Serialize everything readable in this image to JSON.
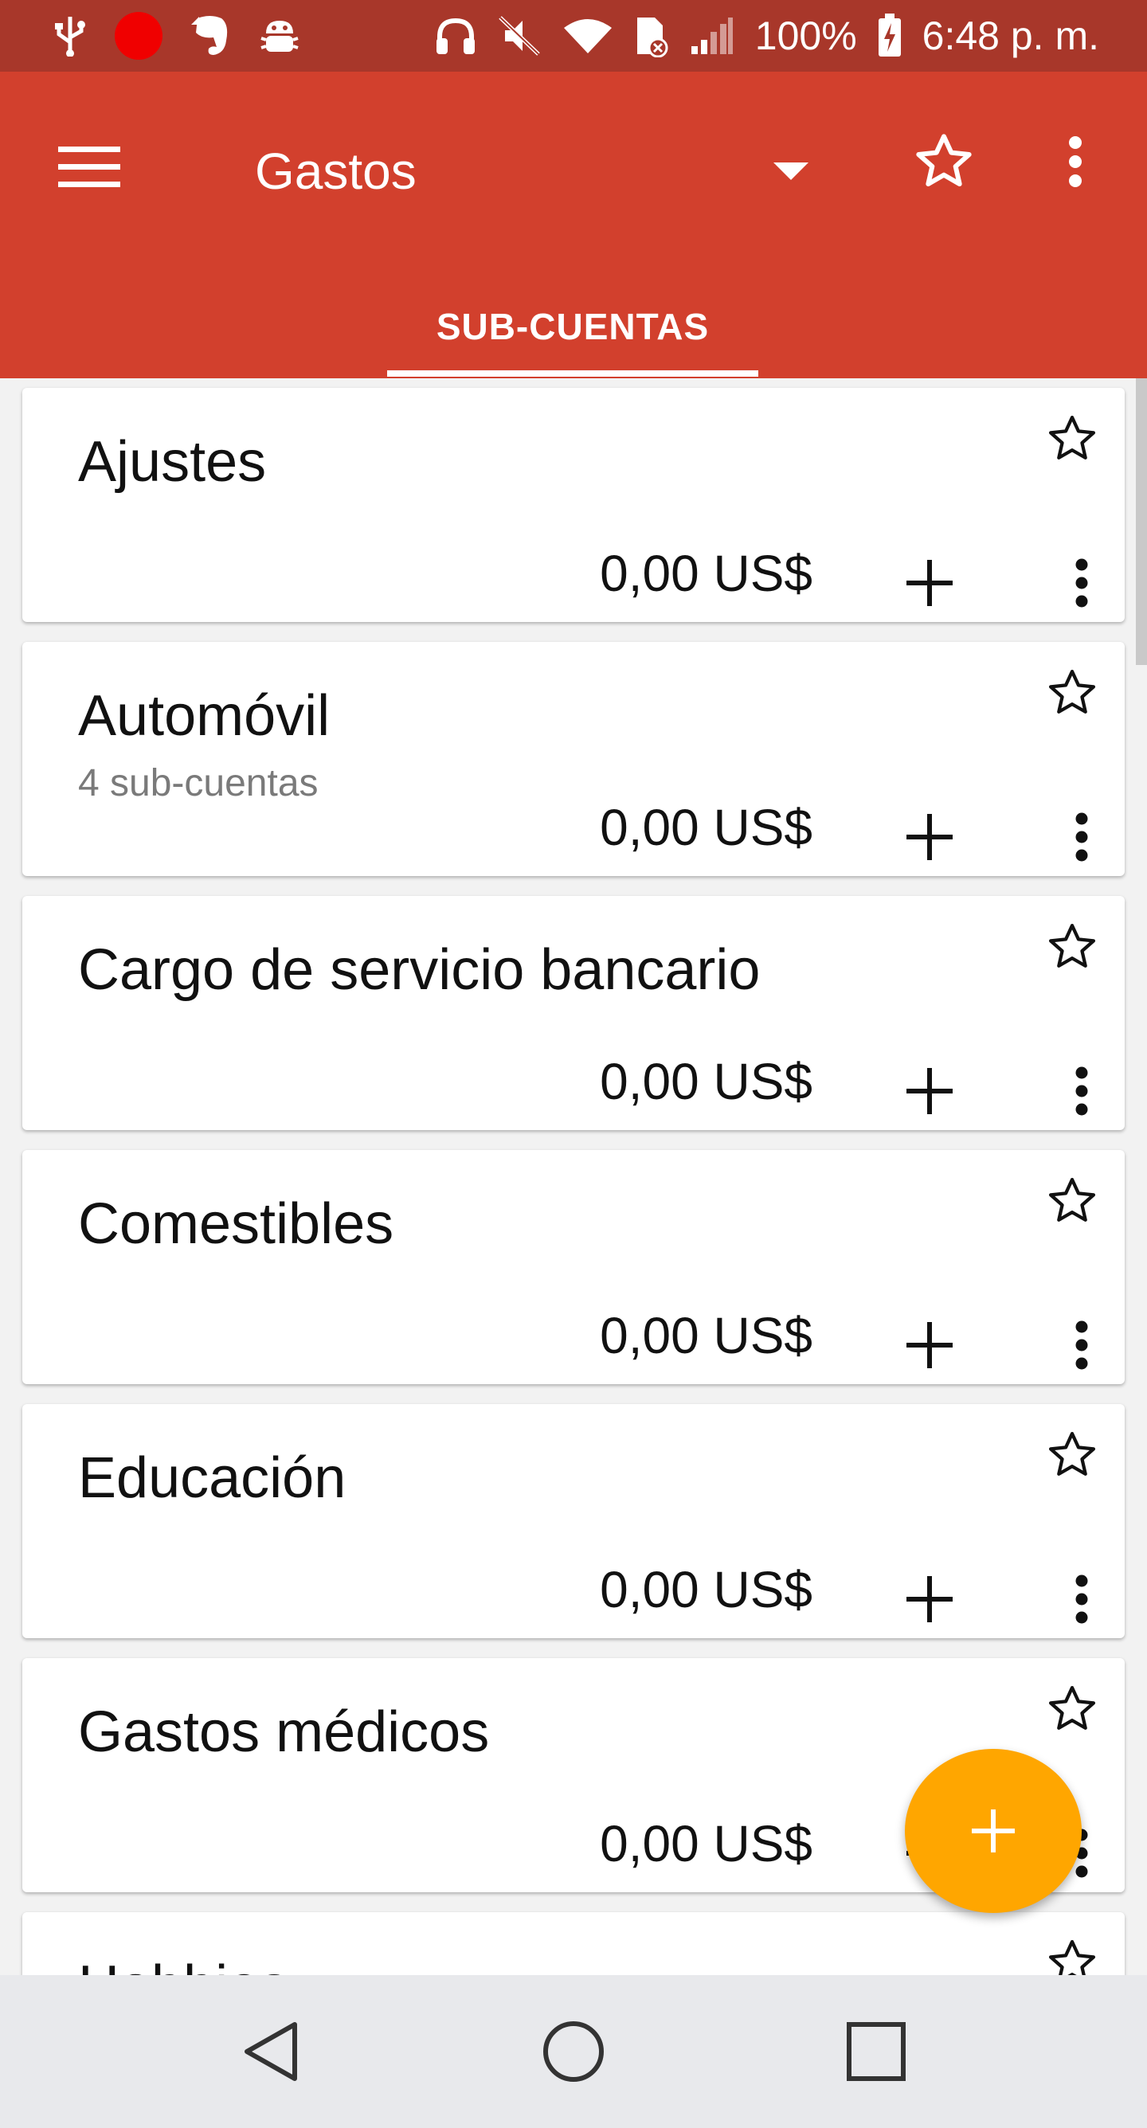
{
  "status_bar": {
    "battery": "100%",
    "time": "6:48 p. m.",
    "icons": [
      "usb-icon",
      "record-icon",
      "evernote-icon",
      "android-debug-icon",
      "headphones-icon",
      "mute-icon",
      "wifi-icon",
      "sim-icon",
      "signal-icon",
      "battery-icon"
    ]
  },
  "app_bar": {
    "title": "Gastos",
    "tab_label": "SUB-CUENTAS",
    "colors": {
      "primary": "#d2402d",
      "status": "#a8372a",
      "accent": "#ffa600"
    }
  },
  "accounts": [
    {
      "name": "Ajustes",
      "subtitle": "",
      "balance": "0,00 US$"
    },
    {
      "name": "Automóvil",
      "subtitle": "4 sub-cuentas",
      "balance": "0,00 US$"
    },
    {
      "name": "Cargo de servicio bancario",
      "subtitle": "",
      "balance": "0,00 US$"
    },
    {
      "name": "Comestibles",
      "subtitle": "",
      "balance": "0,00 US$"
    },
    {
      "name": "Educación",
      "subtitle": "",
      "balance": "0,00 US$"
    },
    {
      "name": "Gastos médicos",
      "subtitle": "",
      "balance": "0,00 US$"
    },
    {
      "name": "Hobbies",
      "subtitle": "",
      "balance": ""
    }
  ]
}
